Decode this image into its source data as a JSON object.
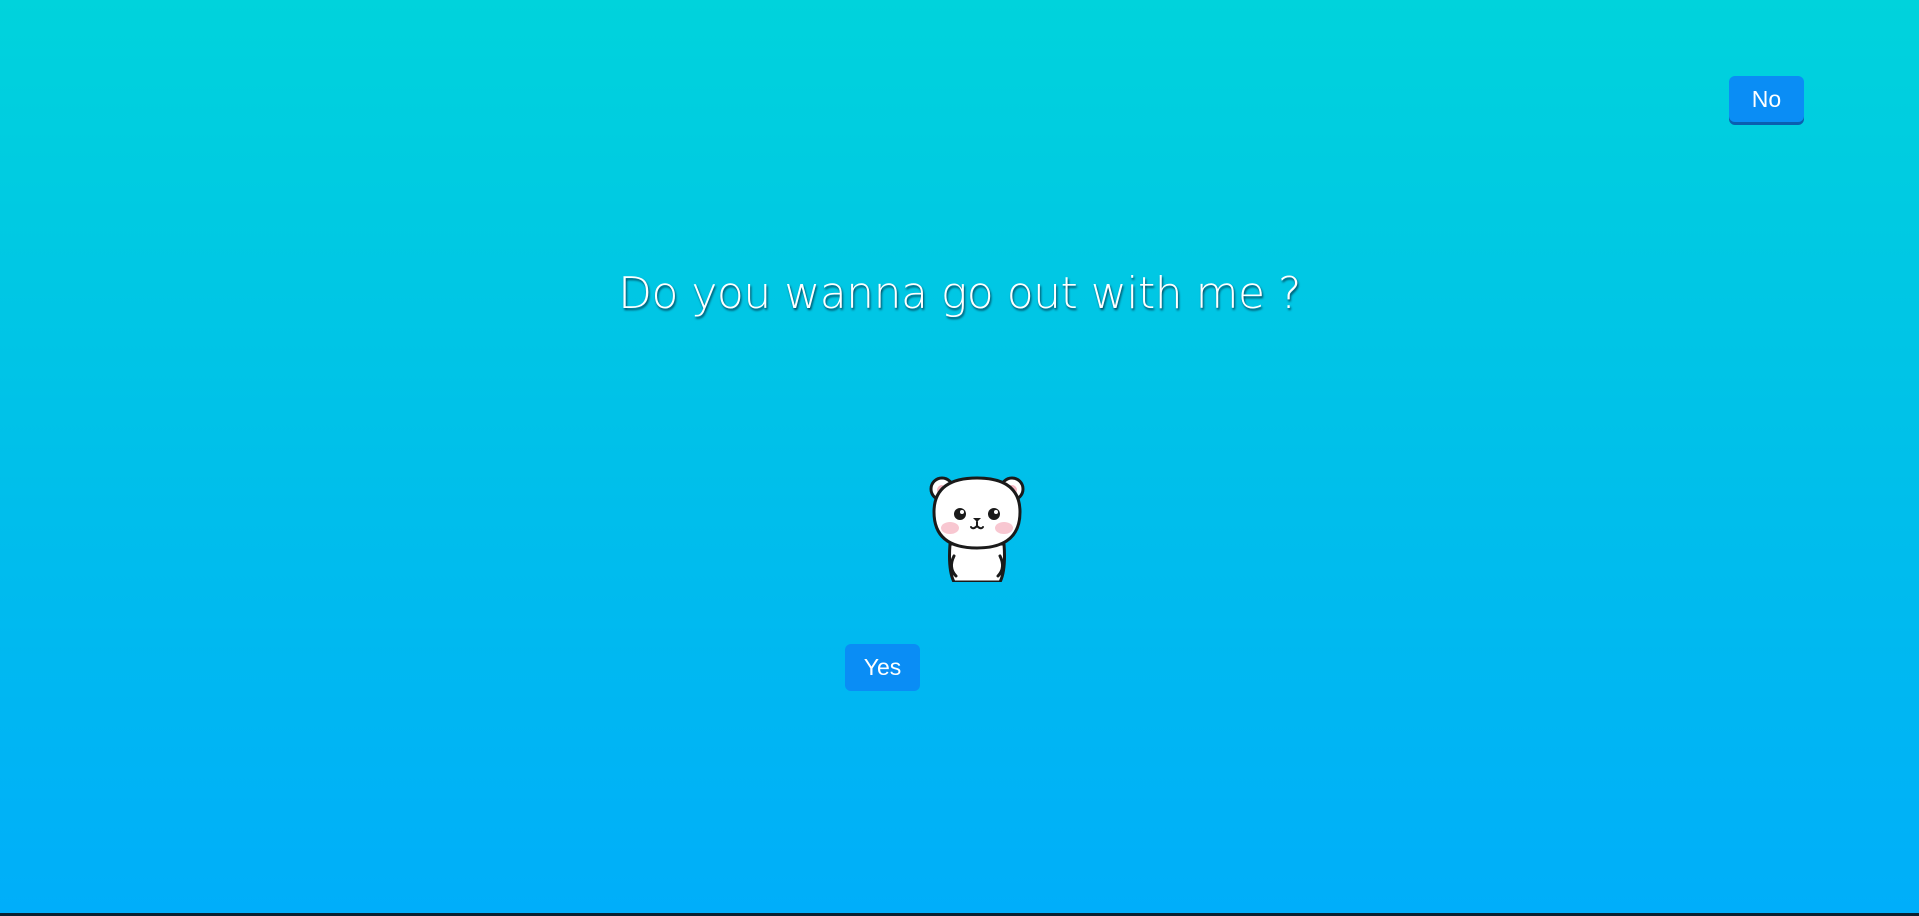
{
  "question": "Do you wanna go out with me ?",
  "buttons": {
    "no_label": "No",
    "yes_label": "Yes"
  },
  "image": {
    "icon": "bear-sticker-icon"
  },
  "colors": {
    "background_top": "#00d3dc",
    "background_bottom": "#00aefa",
    "button": "#0a8df5",
    "text": "#ffffff"
  }
}
